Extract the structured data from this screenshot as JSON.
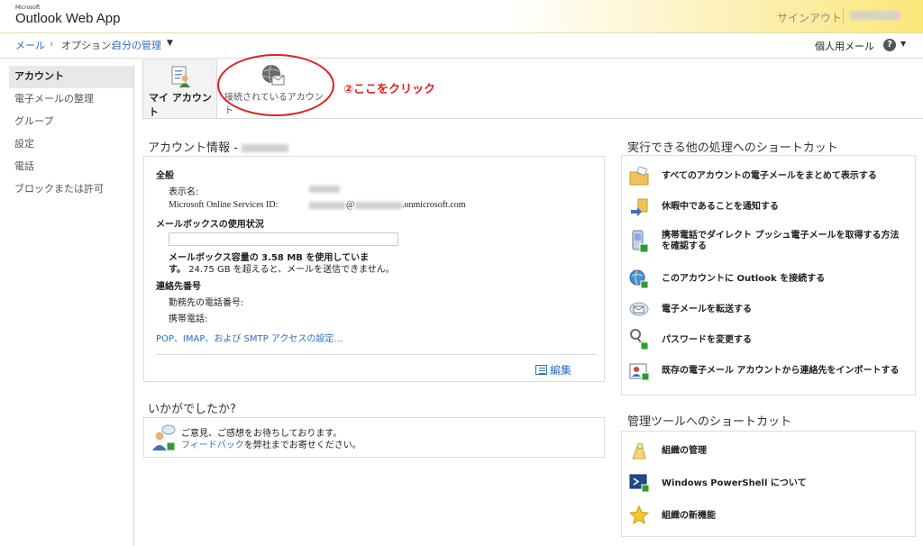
{
  "app": {
    "brand_small": "Microsoft",
    "brand_name": "Outlook Web App",
    "signout": "サインアウト"
  },
  "breadcrumb": {
    "mail": "メール",
    "separator": "›",
    "options": "オプション:",
    "current": "自分の管理",
    "dropdown": "▼"
  },
  "header_right": {
    "personal_mail": "個人用メール",
    "help": "?",
    "help_dropdown": "▼"
  },
  "sidebar": {
    "items": [
      {
        "label": "アカウント",
        "active": true
      },
      {
        "label": "電子メールの整理",
        "active": false
      },
      {
        "label": "グループ",
        "active": false
      },
      {
        "label": "設定",
        "active": false
      },
      {
        "label": "電話",
        "active": false
      },
      {
        "label": "ブロックまたは許可",
        "active": false
      }
    ]
  },
  "toolbar": {
    "my_account": "マイ アカウント",
    "connected_accounts": "接続されているアカウント"
  },
  "annotation": {
    "text": "②ここをクリック",
    "color": "#e02020"
  },
  "account": {
    "title": "アカウント情報 -",
    "general_heading": "全般",
    "display_name_label": "表示名:",
    "msos_id_label": "Microsoft Online Services ID:",
    "msos_id_suffix": "@",
    "msos_id_domain": ".onmicrosoft.com",
    "mailbox_heading": "メールボックスの使用状況",
    "mailbox_line1": "メールボックス容量の 3.58 MB を使用していま",
    "mailbox_line2_bold": "す。",
    "mailbox_line2_rest": "24.75 GB を超えると、メールを送信できません。",
    "contact_heading": "連絡先番号",
    "work_phone_label": "勤務先の電話番号:",
    "mobile_label": "携帯電話:",
    "pop_link": "POP、IMAP、および SMTP アクセスの設定...",
    "edit": "編集"
  },
  "feedback": {
    "title": "いかがでしたか?",
    "line1": "ご意見、ご感想をお待ちしております。",
    "link": "フィードバック",
    "line2_rest": "を弊社までお寄せください。"
  },
  "shortcuts": {
    "title": "実行できる他の処理へのショートカット",
    "items": [
      {
        "label": "すべてのアカウントの電子メールをまとめて表示する",
        "icon": "folder-envelope-icon"
      },
      {
        "label": "休暇中であることを通知する",
        "icon": "arrow-note-icon"
      },
      {
        "label": "携帯電話でダイレクト プッシュ電子メールを取得する方法を確認する",
        "icon": "mobile-phone-icon"
      },
      {
        "label": "このアカウントに Outlook を接続する",
        "icon": "globe-mail-icon"
      },
      {
        "label": "電子メールを転送する",
        "icon": "forward-mail-icon"
      },
      {
        "label": "パスワードを変更する",
        "icon": "keys-icon"
      },
      {
        "label": "既存の電子メール アカウントから連絡先をインポートする",
        "icon": "contact-card-icon"
      }
    ]
  },
  "admin": {
    "title": "管理ツールへのショートカット",
    "items": [
      {
        "label": "組織の管理",
        "icon": "org-manage-icon"
      },
      {
        "label": "Windows PowerShell について",
        "icon": "powershell-icon"
      },
      {
        "label": "組織の新機能",
        "icon": "star-icon"
      }
    ]
  }
}
